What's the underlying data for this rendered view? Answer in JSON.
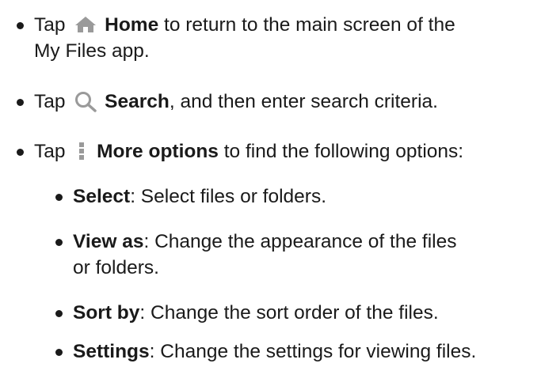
{
  "items": [
    {
      "prefix": "Tap",
      "icon": "home-icon",
      "bold": "Home",
      "rest": "to return to the main screen of the",
      "continuation": "My Files app."
    },
    {
      "prefix": "Tap",
      "icon": "search-icon",
      "bold": "Search",
      "rest": ", and then enter search criteria."
    },
    {
      "prefix": "Tap",
      "icon": "more-options-icon",
      "bold": "More options",
      "rest": "to find the following options:"
    }
  ],
  "subitems": [
    {
      "bold": "Select",
      "rest": ": Select files or folders."
    },
    {
      "bold": "View as",
      "rest": ": Change the appearance of the files",
      "continuation": "or folders."
    },
    {
      "bold": "Sort by",
      "rest": ": Change the sort order of the files."
    },
    {
      "bold": "Settings",
      "rest": ": Change the settings for viewing files."
    }
  ],
  "colors": {
    "text": "#1a1a1a",
    "icon": "#9a9a9a"
  }
}
